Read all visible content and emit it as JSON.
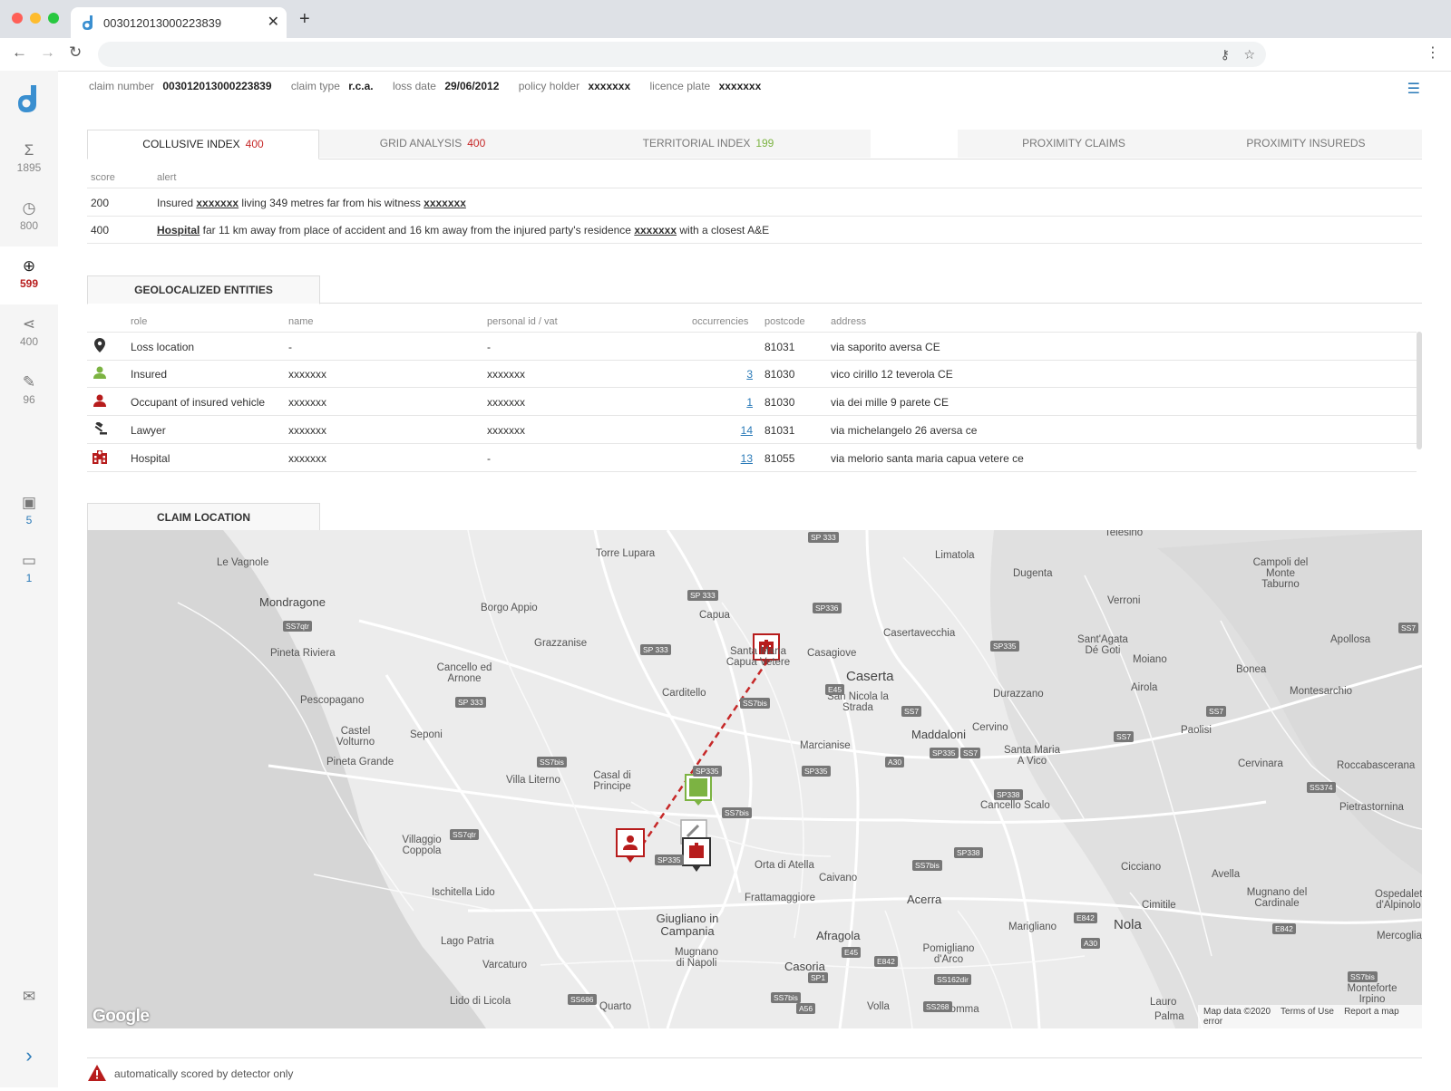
{
  "browser": {
    "tab_title": "003012013000223839",
    "new_tab_label": "+",
    "close_label": "✕"
  },
  "sidebar": {
    "items": [
      {
        "icon": "sigma-icon",
        "glyph": "Σ",
        "count": "1895"
      },
      {
        "icon": "speedometer-icon",
        "glyph": "◷",
        "count": "800"
      },
      {
        "icon": "globe-icon",
        "glyph": "⊕",
        "count": "599"
      },
      {
        "icon": "share-icon",
        "glyph": "⋖",
        "count": "400"
      },
      {
        "icon": "magic-wand-icon",
        "glyph": "✎",
        "count": "96"
      },
      {
        "icon": "calendar-check-icon",
        "glyph": "▣",
        "count": "5"
      },
      {
        "icon": "folder-icon",
        "glyph": "▭",
        "count": "1"
      },
      {
        "icon": "mail-icon",
        "glyph": "✉"
      },
      {
        "icon": "chevron-right-icon",
        "glyph": "›"
      }
    ]
  },
  "claim": {
    "number_label": "claim number",
    "number": "003012013000223839",
    "type_label": "claim type",
    "type": "r.c.a.",
    "loss_date_label": "loss date",
    "loss_date": "29/06/2012",
    "holder_label": "policy holder",
    "holder": "xxxxxxx",
    "plate_label": "licence plate",
    "plate": "xxxxxxx"
  },
  "tabs": [
    {
      "label": "COLLUSIVE INDEX",
      "score": "400"
    },
    {
      "label": "GRID ANALYSIS",
      "score": "400"
    },
    {
      "label": "TERRITORIAL INDEX",
      "score": "199"
    },
    {
      "label": "PROXIMITY CLAIMS"
    },
    {
      "label": "PROXIMITY INSUREDS"
    }
  ],
  "alerts": {
    "headers": {
      "score": "score",
      "alert": "alert"
    },
    "rows": [
      {
        "score": "200",
        "pre": "Insured ",
        "link1": "xxxxxxx",
        "mid": " living 349 metres far from his witness ",
        "link2": "xxxxxxx",
        "post": ""
      },
      {
        "score": "400",
        "pre": "",
        "link1": "Hospital",
        "mid": " far 11 km away from place of accident and 16 km away from the injured party's residence ",
        "link2": "xxxxxxx",
        "post": " with a closest A&E"
      }
    ]
  },
  "entities": {
    "title": "GEOLOCALIZED ENTITIES",
    "headers": {
      "role": "role",
      "name": "name",
      "pid": "personal id / vat",
      "occ": "occurrencies",
      "postcode": "postcode",
      "address": "address"
    },
    "rows": [
      {
        "icon": "map-pin-icon",
        "role": "Loss location",
        "name": "-",
        "pid": "-",
        "occ": "",
        "postcode": "81031",
        "address": "via saporito aversa CE"
      },
      {
        "icon": "person-green-icon",
        "role": "Insured",
        "name": "xxxxxxx",
        "pid": "xxxxxxx",
        "occ": "3",
        "postcode": "81030",
        "address": "vico cirillo 12 teverola CE"
      },
      {
        "icon": "person-red-icon",
        "role": "Occupant of insured vehicle",
        "name": "xxxxxxx",
        "pid": "xxxxxxx",
        "occ": "1",
        "postcode": "81030",
        "address": "via dei mille 9 parete CE"
      },
      {
        "icon": "gavel-icon",
        "role": "Lawyer",
        "name": "xxxxxxx",
        "pid": "xxxxxxx",
        "occ": "14",
        "postcode": "81031",
        "address": "via michelangelo 26 aversa ce"
      },
      {
        "icon": "hospital-icon",
        "role": "Hospital",
        "name": "xxxxxxx",
        "pid": "-",
        "occ": "13",
        "postcode": "81055",
        "address": "via melorio santa maria capua vetere ce"
      }
    ]
  },
  "map": {
    "title": "CLAIM LOCATION",
    "places": [
      "Telesino",
      "Le Vagnole",
      "Torre Lupara",
      "Limatola",
      "Dugenta",
      "Campoli del Monte Taburno",
      "Mondragone",
      "Borgo Appio",
      "Capua",
      "Verroni",
      "Sant'Agata Dé Goti",
      "Apollosa",
      "Pineta Riviera",
      "Grazzanise",
      "Casertavecchia",
      "Moiano",
      "Cancello ed Arnone",
      "Santa Maria Capua Vetere",
      "Casagiove",
      "Bonea",
      "Montesarchio",
      "Carditello",
      "Caserta",
      "Airola",
      "Pescopagano",
      "San Nicola la Strada",
      "Durazzano",
      "Castel Volturno",
      "Seponi",
      "Marcianise",
      "Maddaloni",
      "Cervino",
      "Paolisi",
      "Pineta Grande",
      "Santa Maria A Vico",
      "Cervinara",
      "Roccabascerana",
      "Villa Literno",
      "Casal di Principe",
      "Cancello Scalo",
      "Pietrastornina",
      "Villaggio Coppola",
      "Orta di Atella",
      "Cicciano",
      "Avella",
      "Caivano",
      "Ischitella Lido",
      "Acerra",
      "Mugnano del Cardinale",
      "Frattamaggiore",
      "Cimitile",
      "Ospedaletto d'Alpinolo",
      "Giugliano in Campania",
      "Afragola",
      "Marigliano",
      "Nola",
      "Lago Patria",
      "Pomigliano d'Arco",
      "Mercogliano",
      "Varcaturo",
      "Mugnano di Napoli",
      "Casoria",
      "Monteforte Irpino",
      "Lido di Licola",
      "Quarto",
      "Volla",
      "Somma",
      "Lauro",
      "Palma"
    ],
    "attribution": [
      "Map data ©2020",
      "Terms of Use",
      "Report a map error"
    ],
    "logo": "Google"
  },
  "footer": {
    "note": "automatically scored by detector only"
  },
  "colors": {
    "accent": "#2a7ab8",
    "alert_red": "#c62828",
    "green": "#7cb342"
  }
}
